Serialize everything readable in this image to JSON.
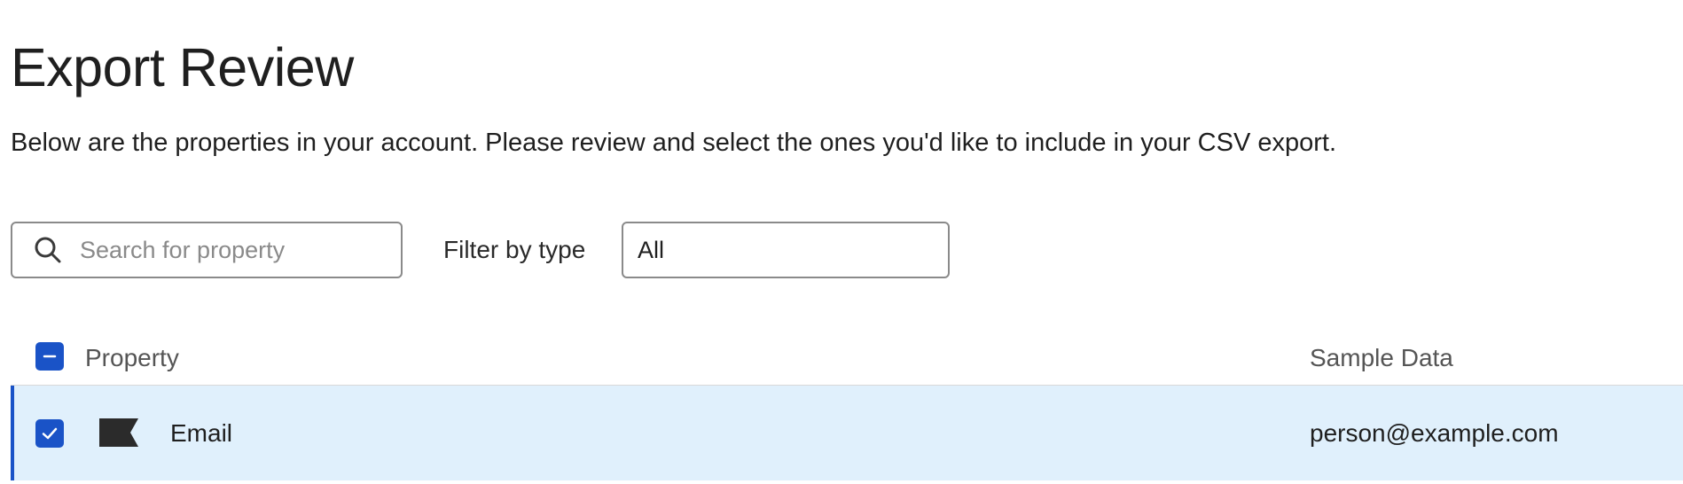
{
  "header": {
    "title": "Export Review",
    "description": "Below are the properties in your account. Please review and select the ones you'd like to include in your CSV export."
  },
  "search": {
    "placeholder": "Search for property",
    "value": "",
    "icon": "search-icon"
  },
  "filter": {
    "label": "Filter by type",
    "selected": "All"
  },
  "table": {
    "columns": {
      "property": "Property",
      "sample_data": "Sample Data"
    },
    "select_all_state": "indeterminate",
    "rows": [
      {
        "property": "Email",
        "sample_data": "person@example.com",
        "selected": true,
        "icon": "flag-icon"
      }
    ]
  },
  "colors": {
    "accent": "#1a53c7",
    "row_selected_bg": "#e0f0fc",
    "border": "#8a8a8a",
    "text": "#1f1f1f",
    "muted_text": "#555555"
  }
}
